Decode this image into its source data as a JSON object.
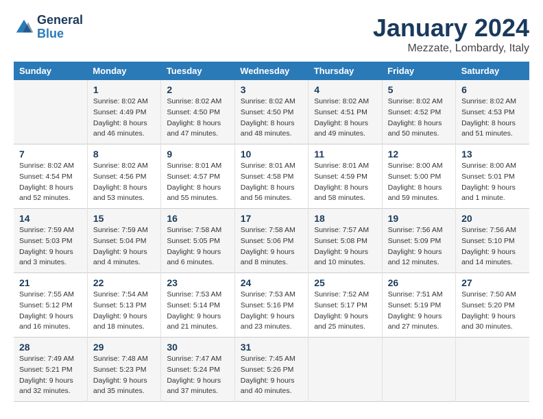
{
  "logo": {
    "line1": "General",
    "line2": "Blue"
  },
  "title": "January 2024",
  "location": "Mezzate, Lombardy, Italy",
  "weekdays": [
    "Sunday",
    "Monday",
    "Tuesday",
    "Wednesday",
    "Thursday",
    "Friday",
    "Saturday"
  ],
  "weeks": [
    [
      {
        "day": "",
        "sunrise": "",
        "sunset": "",
        "daylight": ""
      },
      {
        "day": "1",
        "sunrise": "Sunrise: 8:02 AM",
        "sunset": "Sunset: 4:49 PM",
        "daylight": "Daylight: 8 hours and 46 minutes."
      },
      {
        "day": "2",
        "sunrise": "Sunrise: 8:02 AM",
        "sunset": "Sunset: 4:50 PM",
        "daylight": "Daylight: 8 hours and 47 minutes."
      },
      {
        "day": "3",
        "sunrise": "Sunrise: 8:02 AM",
        "sunset": "Sunset: 4:50 PM",
        "daylight": "Daylight: 8 hours and 48 minutes."
      },
      {
        "day": "4",
        "sunrise": "Sunrise: 8:02 AM",
        "sunset": "Sunset: 4:51 PM",
        "daylight": "Daylight: 8 hours and 49 minutes."
      },
      {
        "day": "5",
        "sunrise": "Sunrise: 8:02 AM",
        "sunset": "Sunset: 4:52 PM",
        "daylight": "Daylight: 8 hours and 50 minutes."
      },
      {
        "day": "6",
        "sunrise": "Sunrise: 8:02 AM",
        "sunset": "Sunset: 4:53 PM",
        "daylight": "Daylight: 8 hours and 51 minutes."
      }
    ],
    [
      {
        "day": "7",
        "sunrise": "Sunrise: 8:02 AM",
        "sunset": "Sunset: 4:54 PM",
        "daylight": "Daylight: 8 hours and 52 minutes."
      },
      {
        "day": "8",
        "sunrise": "Sunrise: 8:02 AM",
        "sunset": "Sunset: 4:56 PM",
        "daylight": "Daylight: 8 hours and 53 minutes."
      },
      {
        "day": "9",
        "sunrise": "Sunrise: 8:01 AM",
        "sunset": "Sunset: 4:57 PM",
        "daylight": "Daylight: 8 hours and 55 minutes."
      },
      {
        "day": "10",
        "sunrise": "Sunrise: 8:01 AM",
        "sunset": "Sunset: 4:58 PM",
        "daylight": "Daylight: 8 hours and 56 minutes."
      },
      {
        "day": "11",
        "sunrise": "Sunrise: 8:01 AM",
        "sunset": "Sunset: 4:59 PM",
        "daylight": "Daylight: 8 hours and 58 minutes."
      },
      {
        "day": "12",
        "sunrise": "Sunrise: 8:00 AM",
        "sunset": "Sunset: 5:00 PM",
        "daylight": "Daylight: 8 hours and 59 minutes."
      },
      {
        "day": "13",
        "sunrise": "Sunrise: 8:00 AM",
        "sunset": "Sunset: 5:01 PM",
        "daylight": "Daylight: 9 hours and 1 minute."
      }
    ],
    [
      {
        "day": "14",
        "sunrise": "Sunrise: 7:59 AM",
        "sunset": "Sunset: 5:03 PM",
        "daylight": "Daylight: 9 hours and 3 minutes."
      },
      {
        "day": "15",
        "sunrise": "Sunrise: 7:59 AM",
        "sunset": "Sunset: 5:04 PM",
        "daylight": "Daylight: 9 hours and 4 minutes."
      },
      {
        "day": "16",
        "sunrise": "Sunrise: 7:58 AM",
        "sunset": "Sunset: 5:05 PM",
        "daylight": "Daylight: 9 hours and 6 minutes."
      },
      {
        "day": "17",
        "sunrise": "Sunrise: 7:58 AM",
        "sunset": "Sunset: 5:06 PM",
        "daylight": "Daylight: 9 hours and 8 minutes."
      },
      {
        "day": "18",
        "sunrise": "Sunrise: 7:57 AM",
        "sunset": "Sunset: 5:08 PM",
        "daylight": "Daylight: 9 hours and 10 minutes."
      },
      {
        "day": "19",
        "sunrise": "Sunrise: 7:56 AM",
        "sunset": "Sunset: 5:09 PM",
        "daylight": "Daylight: 9 hours and 12 minutes."
      },
      {
        "day": "20",
        "sunrise": "Sunrise: 7:56 AM",
        "sunset": "Sunset: 5:10 PM",
        "daylight": "Daylight: 9 hours and 14 minutes."
      }
    ],
    [
      {
        "day": "21",
        "sunrise": "Sunrise: 7:55 AM",
        "sunset": "Sunset: 5:12 PM",
        "daylight": "Daylight: 9 hours and 16 minutes."
      },
      {
        "day": "22",
        "sunrise": "Sunrise: 7:54 AM",
        "sunset": "Sunset: 5:13 PM",
        "daylight": "Daylight: 9 hours and 18 minutes."
      },
      {
        "day": "23",
        "sunrise": "Sunrise: 7:53 AM",
        "sunset": "Sunset: 5:14 PM",
        "daylight": "Daylight: 9 hours and 21 minutes."
      },
      {
        "day": "24",
        "sunrise": "Sunrise: 7:53 AM",
        "sunset": "Sunset: 5:16 PM",
        "daylight": "Daylight: 9 hours and 23 minutes."
      },
      {
        "day": "25",
        "sunrise": "Sunrise: 7:52 AM",
        "sunset": "Sunset: 5:17 PM",
        "daylight": "Daylight: 9 hours and 25 minutes."
      },
      {
        "day": "26",
        "sunrise": "Sunrise: 7:51 AM",
        "sunset": "Sunset: 5:19 PM",
        "daylight": "Daylight: 9 hours and 27 minutes."
      },
      {
        "day": "27",
        "sunrise": "Sunrise: 7:50 AM",
        "sunset": "Sunset: 5:20 PM",
        "daylight": "Daylight: 9 hours and 30 minutes."
      }
    ],
    [
      {
        "day": "28",
        "sunrise": "Sunrise: 7:49 AM",
        "sunset": "Sunset: 5:21 PM",
        "daylight": "Daylight: 9 hours and 32 minutes."
      },
      {
        "day": "29",
        "sunrise": "Sunrise: 7:48 AM",
        "sunset": "Sunset: 5:23 PM",
        "daylight": "Daylight: 9 hours and 35 minutes."
      },
      {
        "day": "30",
        "sunrise": "Sunrise: 7:47 AM",
        "sunset": "Sunset: 5:24 PM",
        "daylight": "Daylight: 9 hours and 37 minutes."
      },
      {
        "day": "31",
        "sunrise": "Sunrise: 7:45 AM",
        "sunset": "Sunset: 5:26 PM",
        "daylight": "Daylight: 9 hours and 40 minutes."
      },
      {
        "day": "",
        "sunrise": "",
        "sunset": "",
        "daylight": ""
      },
      {
        "day": "",
        "sunrise": "",
        "sunset": "",
        "daylight": ""
      },
      {
        "day": "",
        "sunrise": "",
        "sunset": "",
        "daylight": ""
      }
    ]
  ]
}
